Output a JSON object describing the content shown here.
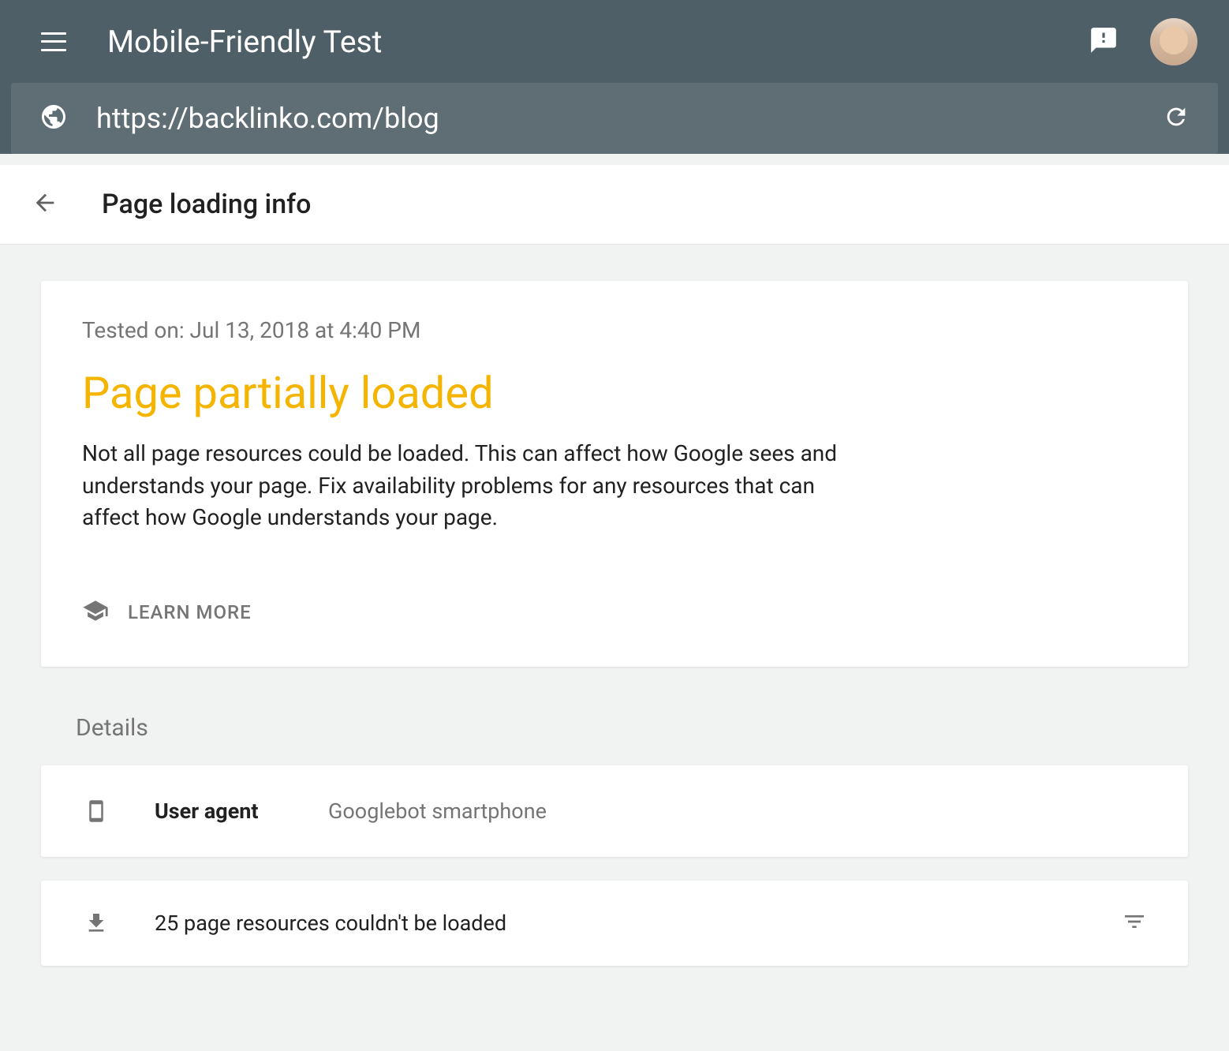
{
  "header": {
    "title": "Mobile-Friendly Test"
  },
  "urlBar": {
    "url": "https://backlinko.com/blog"
  },
  "subheader": {
    "title": "Page loading info"
  },
  "statusCard": {
    "testedOn": "Tested on: Jul 13, 2018 at 4:40 PM",
    "statusTitle": "Page partially loaded",
    "statusDescription": "Not all page resources could be loaded. This can affect how Google sees and understands your page. Fix availability problems for any resources that can affect how Google understands your page.",
    "learnMore": "LEARN MORE"
  },
  "details": {
    "sectionLabel": "Details",
    "userAgent": {
      "label": "User agent",
      "value": "Googlebot smartphone"
    },
    "resources": {
      "text": "25 page resources couldn't be loaded"
    }
  }
}
